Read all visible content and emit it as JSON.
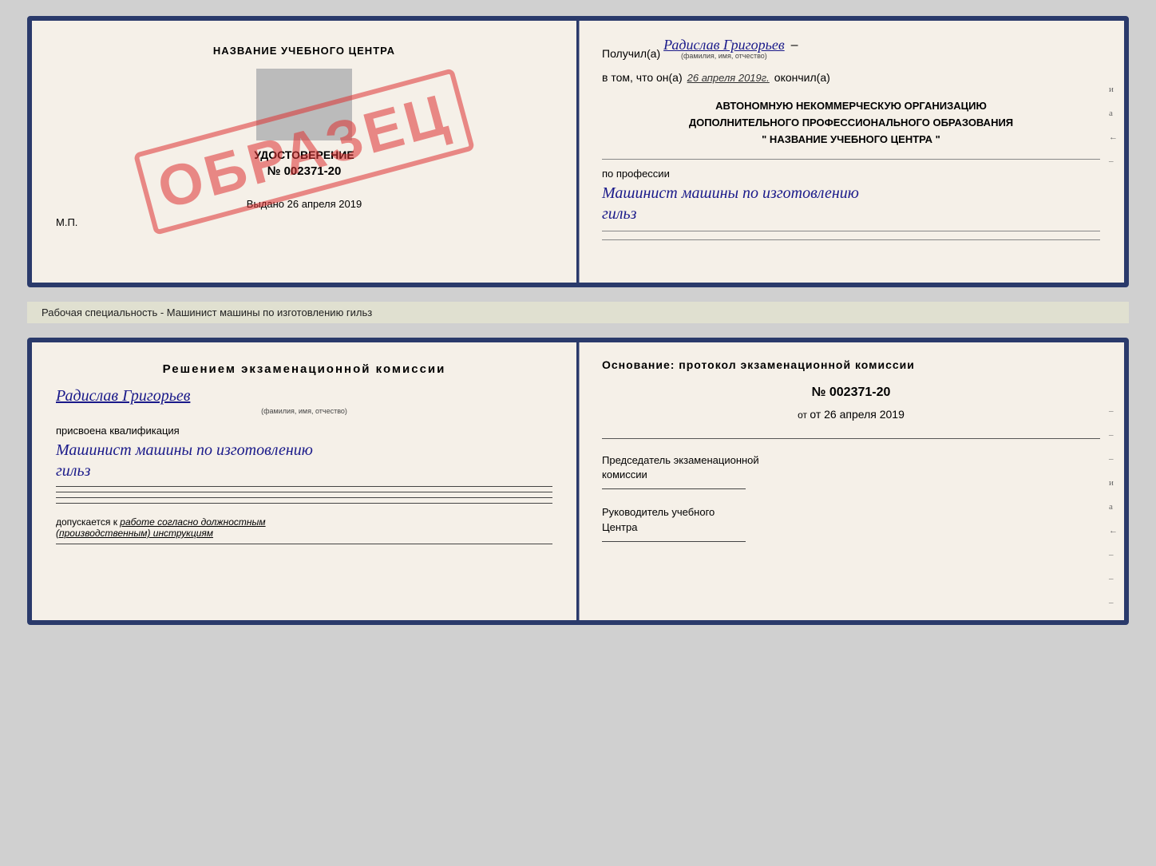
{
  "topCard": {
    "left": {
      "schoolName": "НАЗВАНИЕ УЧЕБНОГО ЦЕНТРА",
      "udostoverenie": "УДОСТОВЕРЕНИЕ",
      "number": "№ 002371-20",
      "vudano": "Выдано 26 апреля 2019",
      "mp": "М.П.",
      "stamp": "ОБРАЗЕЦ"
    },
    "right": {
      "poluchilLabel": "Получил(а)",
      "personName": "Радислав Григорьев",
      "fioSubtitle": "(фамилия, имя, отчество)",
      "vtomLabel": "в том, что он(а)",
      "date": "26 апреля 2019г.",
      "okonchilLabel": "окончил(а)",
      "orgLine1": "АВТОНОМНУЮ НЕКОММЕРЧЕСКУЮ ОРГАНИЗАЦИЮ",
      "orgLine2": "ДОПОЛНИТЕЛЬНОГО ПРОФЕССИОНАЛЬНОГО ОБРАЗОВАНИЯ",
      "orgLine3": "\"  НАЗВАНИЕ УЧЕБНОГО ЦЕНТРА  \"",
      "proLabel": "по профессии",
      "profName1": "Машинист машины по изготовлению",
      "profName2": "гильз"
    }
  },
  "separator": "Рабочая специальность - Машинист машины по изготовлению гильз",
  "bottomCard": {
    "left": {
      "decisionTitle": "Решением  экзаменационной  комиссии",
      "personName": "Радислав Григорьев",
      "fioSubtitle": "(фамилия, имя, отчество)",
      "prisvoenaLabel": "присвоена квалификация",
      "qualName1": "Машинист машины по изготовлению",
      "qualName2": "гильз",
      "dopLabel": "допускается к",
      "dopValue": "работе согласно должностным",
      "dopValue2": "(производственным) инструкциям"
    },
    "right": {
      "osnovTitle": "Основание: протокол экзаменационной  комиссии",
      "number": "№  002371-20",
      "ot": "от 26 апреля 2019",
      "predsedatelTitle": "Председатель экзаменационной",
      "predsedatelTitle2": "комиссии",
      "rukovoditelTitle": "Руководитель учебного",
      "rukovoditelTitle2": "Центра"
    }
  }
}
